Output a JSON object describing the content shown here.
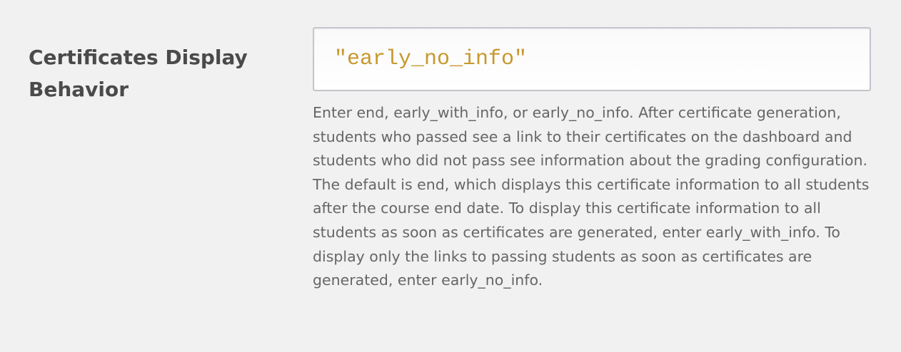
{
  "setting": {
    "label": "Certificates Display Behavior",
    "value": "\"early_no_info\"",
    "help": "Enter end, early_with_info, or early_no_info. After certificate generation, students who passed see a link to their certificates on the dashboard and students who did not pass see information about the grading configuration. The default is end, which displays this certificate information to all students after the course end date. To display this certificate information to all students as soon as certificates are generated, enter early_with_info. To display only the links to passing students as soon as certificates are generated, enter early_no_info."
  },
  "colors": {
    "background": "#f1f1f1",
    "label": "#4a4a4a",
    "value_text": "#c7982e",
    "help_text": "#666666",
    "input_border": "#c3c6cc"
  }
}
